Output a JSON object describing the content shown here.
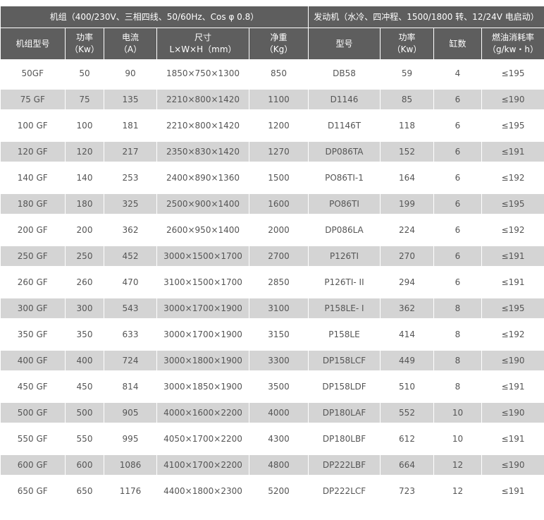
{
  "group_headers": {
    "genset": "机组（400/230V、三相四线、50/60Hz、Cos φ 0.8）",
    "engine": "发动机（水冷、四冲程、1500/1800 转、12/24V 电启动）"
  },
  "columns": [
    {
      "line1": "机组型号",
      "line2": ""
    },
    {
      "line1": "功率",
      "line2": "（Kw）"
    },
    {
      "line1": "电流",
      "line2": "（A）"
    },
    {
      "line1": "尺寸",
      "line2": "L×W×H（mm）"
    },
    {
      "line1": "净重",
      "line2": "（Kg）"
    },
    {
      "line1": "型号",
      "line2": ""
    },
    {
      "line1": "功率",
      "line2": "（Kw）"
    },
    {
      "line1": "缸数",
      "line2": ""
    },
    {
      "line1": "燃油消耗率",
      "line2": "（g/kw・h）"
    }
  ],
  "rows": [
    [
      "50GF",
      "50",
      "90",
      "1850×750×1300",
      "850",
      "DB58",
      "59",
      "4",
      "≤195"
    ],
    [
      "75 GF",
      "75",
      "135",
      "2210×800×1420",
      "1100",
      "D1146",
      "85",
      "6",
      "≤190"
    ],
    [
      "100 GF",
      "100",
      "181",
      "2210×800×1420",
      "1200",
      "D1146T",
      "118",
      "6",
      "≤195"
    ],
    [
      "120 GF",
      "120",
      "217",
      "2350×830×1420",
      "1270",
      "DP086TA",
      "152",
      "6",
      "≤191"
    ],
    [
      "140 GF",
      "140",
      "253",
      "2400×890×1360",
      "1500",
      "PO86TI-1",
      "164",
      "6",
      "≤192"
    ],
    [
      "180 GF",
      "180",
      "325",
      "2500×900×1400",
      "1600",
      "PO86TI",
      "199",
      "6",
      "≤195"
    ],
    [
      "200 GF",
      "200",
      "362",
      "2600×950×1400",
      "2000",
      "DP086LA",
      "224",
      "6",
      "≤192"
    ],
    [
      "250 GF",
      "250",
      "452",
      "3000×1500×1700",
      "2700",
      "P126TI",
      "270",
      "6",
      "≤191"
    ],
    [
      "260 GF",
      "260",
      "470",
      "3100×1500×1700",
      "2850",
      "P126TI- II",
      "294",
      "6",
      "≤191"
    ],
    [
      "300 GF",
      "300",
      "543",
      "3000×1700×1900",
      "3100",
      "P158LE- I",
      "362",
      "8",
      "≤195"
    ],
    [
      "350 GF",
      "350",
      "633",
      "3000×1700×1900",
      "3150",
      "P158LE",
      "414",
      "8",
      "≤192"
    ],
    [
      "400 GF",
      "400",
      "724",
      "3000×1800×1900",
      "3300",
      "DP158LCF",
      "449",
      "8",
      "≤190"
    ],
    [
      "450 GF",
      "450",
      "814",
      "3000×1850×1900",
      "3500",
      "DP158LDF",
      "510",
      "8",
      "≤191"
    ],
    [
      "500 GF",
      "500",
      "905",
      "4000×1600×2200",
      "4000",
      "DP180LAF",
      "552",
      "10",
      "≤190"
    ],
    [
      "550 GF",
      "550",
      "995",
      "4050×1700×2200",
      "4300",
      "DP180LBF",
      "612",
      "10",
      "≤191"
    ],
    [
      "600 GF",
      "600",
      "1086",
      "4100×1700×2200",
      "4800",
      "DP222LBF",
      "664",
      "12",
      "≤190"
    ],
    [
      "650 GF",
      "650",
      "1176",
      "4400×1800×2300",
      "5200",
      "DP222LCF",
      "723",
      "12",
      "≤191"
    ]
  ]
}
